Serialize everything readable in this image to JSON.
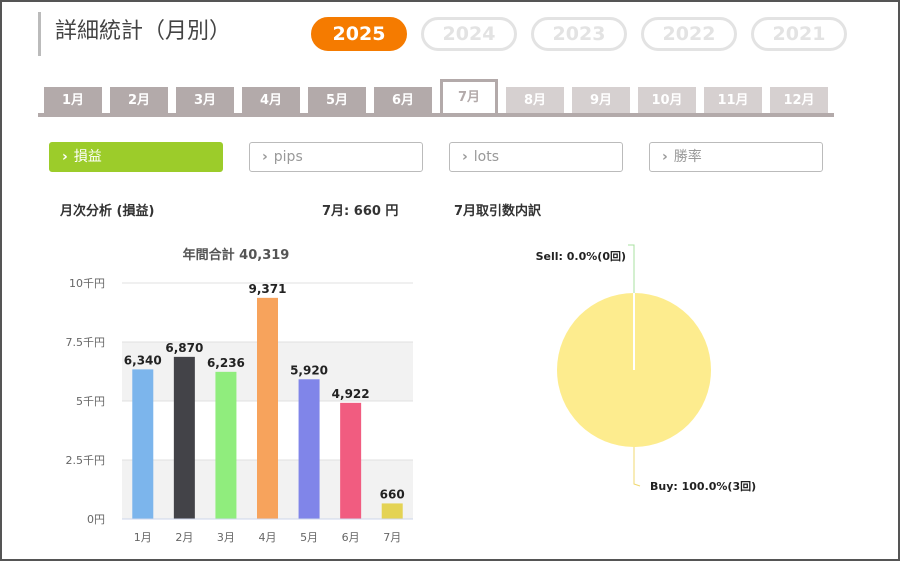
{
  "header": {
    "title": "詳細統計（月別）"
  },
  "years": [
    {
      "label": "2025",
      "active": true
    },
    {
      "label": "2024",
      "active": false
    },
    {
      "label": "2023",
      "active": false
    },
    {
      "label": "2022",
      "active": false
    },
    {
      "label": "2021",
      "active": false
    }
  ],
  "months": [
    {
      "label": "1月",
      "state": "past"
    },
    {
      "label": "2月",
      "state": "past"
    },
    {
      "label": "3月",
      "state": "past"
    },
    {
      "label": "4月",
      "state": "past"
    },
    {
      "label": "5月",
      "state": "past"
    },
    {
      "label": "6月",
      "state": "past"
    },
    {
      "label": "7月",
      "state": "active"
    },
    {
      "label": "8月",
      "state": "future"
    },
    {
      "label": "9月",
      "state": "future"
    },
    {
      "label": "10月",
      "state": "future"
    },
    {
      "label": "11月",
      "state": "future"
    },
    {
      "label": "12月",
      "state": "future"
    }
  ],
  "metrics": [
    {
      "label": "損益",
      "active": true
    },
    {
      "label": "pips",
      "active": false
    },
    {
      "label": "lots",
      "active": false
    },
    {
      "label": "勝率",
      "active": false
    }
  ],
  "summary": {
    "analysis_label": "月次分析 (損益)",
    "month_value": "7月:  660 円",
    "breakdown_label": "7月取引数内訳"
  },
  "chart_data": [
    {
      "type": "bar",
      "title": "年間合計 40,319",
      "categories": [
        "1月",
        "2月",
        "3月",
        "4月",
        "5月",
        "6月",
        "7月"
      ],
      "values": [
        6340,
        6870,
        6236,
        9371,
        5920,
        4922,
        660
      ],
      "value_labels": [
        "6,340",
        "6,870",
        "6,236",
        "9,371",
        "5,920",
        "4,922",
        "660"
      ],
      "colors": [
        "#7cb5ec",
        "#434348",
        "#90ed7d",
        "#f7a35c",
        "#8085e9",
        "#f15c80",
        "#e4d354"
      ],
      "yticks": [
        0,
        2500,
        5000,
        7500,
        10000
      ],
      "ytick_labels": [
        "0円",
        "2.5千円",
        "5千円",
        "7.5千円",
        "10千円"
      ],
      "ylim": [
        0,
        10000
      ],
      "grid": true
    },
    {
      "type": "pie",
      "slices": [
        {
          "label": "Sell: 0.0%(0回)",
          "value": 0.0,
          "color": "#a8e0a0"
        },
        {
          "label": "Buy: 100.0%(3回)",
          "value": 100.0,
          "color": "#fdec8e"
        }
      ]
    }
  ]
}
